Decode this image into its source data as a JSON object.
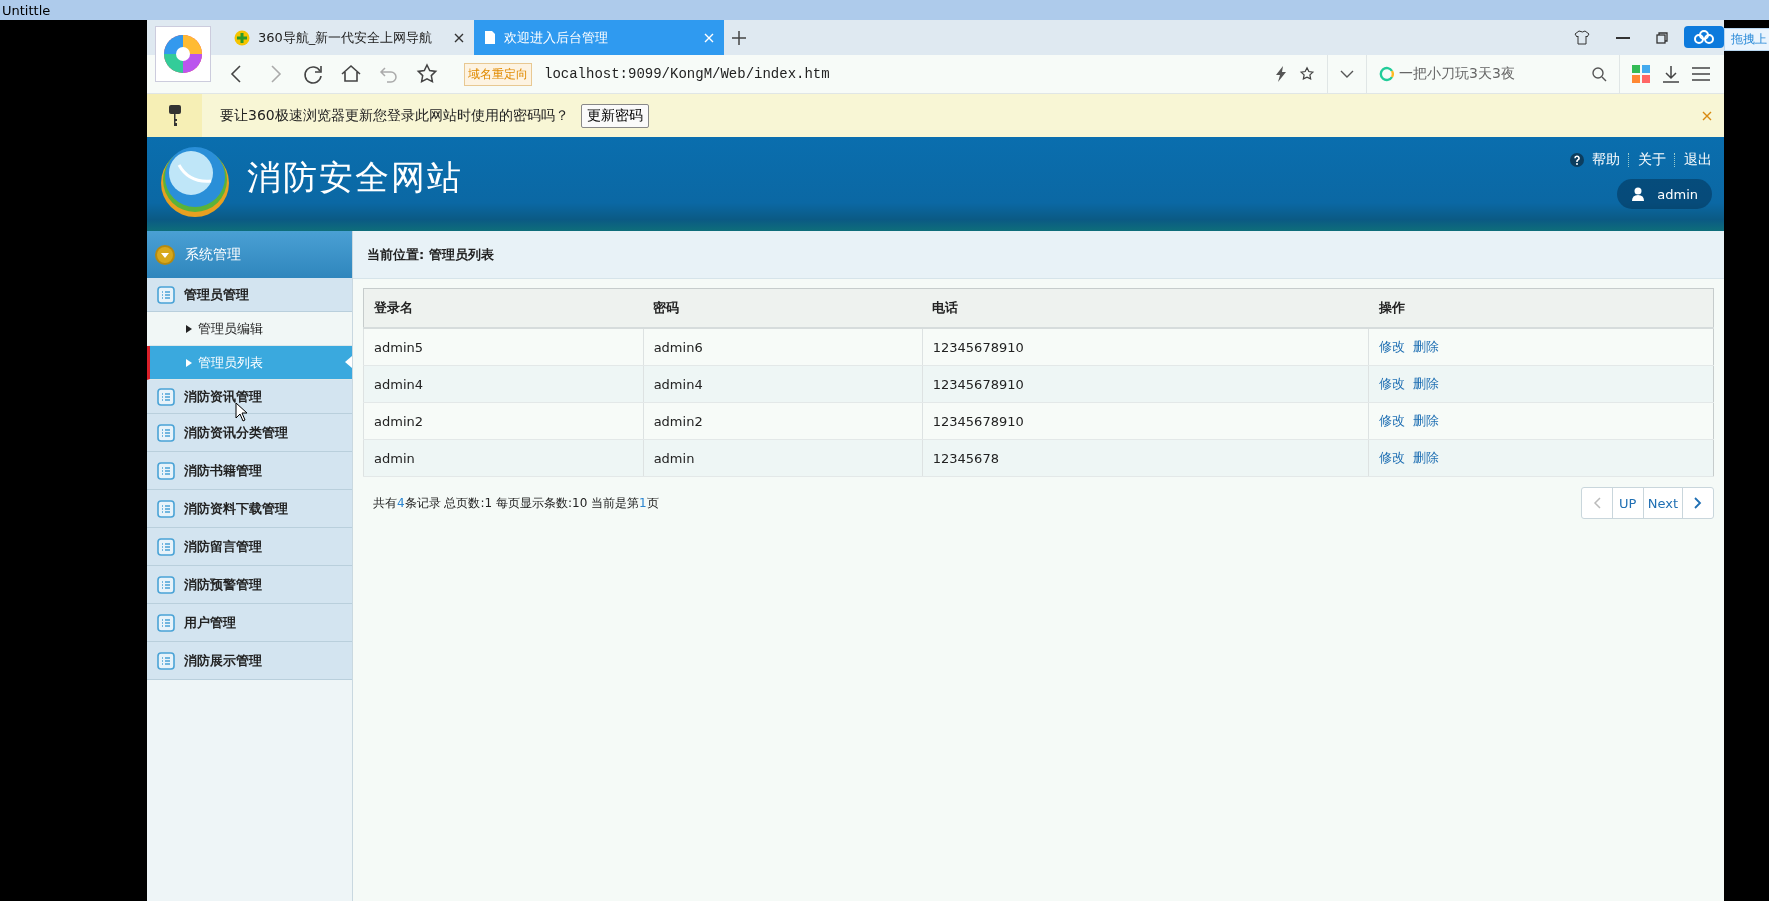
{
  "desktop": {
    "title": "Untittle"
  },
  "browser": {
    "tabs": [
      {
        "title": "360导航_新一代安全上网导航",
        "selected": false
      },
      {
        "title": "欢迎进入后台管理",
        "selected": true
      }
    ],
    "redirect_badge": "域名重定向",
    "url": "localhost:9099/KongM/Web/index.htm",
    "search_placeholder": "一把小刀玩3天3夜",
    "upload_label": "拖拽上"
  },
  "password_bar": {
    "message": "要让360极速浏览器更新您登录此网站时使用的密码吗？",
    "button": "更新密码"
  },
  "site": {
    "title": "消防安全网站",
    "links": [
      "帮助",
      "关于",
      "退出"
    ],
    "user": "admin"
  },
  "sidebar": {
    "header": "系统管理",
    "groups": [
      {
        "label": "管理员管理",
        "children": [
          {
            "label": "管理员编辑",
            "selected": false
          },
          {
            "label": "管理员列表",
            "selected": true
          }
        ]
      },
      {
        "label": "消防资讯管理"
      },
      {
        "label": "消防资讯分类管理"
      },
      {
        "label": "消防书籍管理"
      },
      {
        "label": "消防资料下载管理"
      },
      {
        "label": "消防留言管理"
      },
      {
        "label": "消防预警管理"
      },
      {
        "label": "用户管理"
      },
      {
        "label": "消防展示管理"
      }
    ]
  },
  "breadcrumb": "当前位置: 管理员列表",
  "table": {
    "columns": [
      "登录名",
      "密码",
      "电话",
      "操作"
    ],
    "rows": [
      {
        "login": "admin5",
        "password": "admin6",
        "phone": "12345678910",
        "actions": [
          "修改",
          "删除"
        ]
      },
      {
        "login": "admin4",
        "password": "admin4",
        "phone": "12345678910",
        "actions": [
          "修改",
          "删除"
        ]
      },
      {
        "login": "admin2",
        "password": "admin2",
        "phone": "12345678910",
        "actions": [
          "修改",
          "删除"
        ]
      },
      {
        "login": "admin",
        "password": "admin",
        "phone": "12345678",
        "actions": [
          "修改",
          "删除"
        ]
      }
    ]
  },
  "summary": "共有**4**条记录 总页数:1 每页显示条数:10 当前是第**1**页",
  "pagination": {
    "prev_disabled": true,
    "pages": [
      "UP",
      "Next"
    ]
  }
}
